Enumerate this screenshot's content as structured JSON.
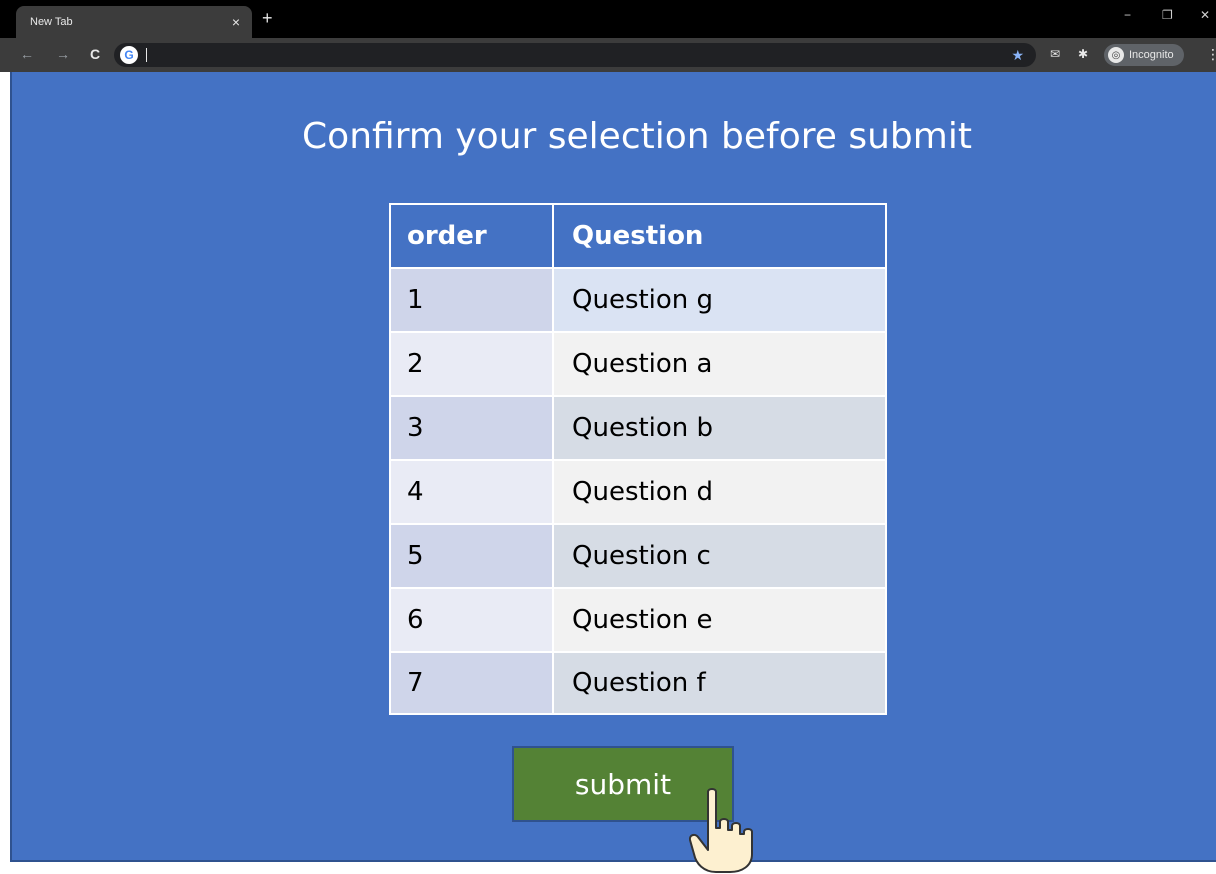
{
  "browser": {
    "tab_title": "New Tab",
    "tab_close": "×",
    "new_tab": "+",
    "minimize": "−",
    "restore": "❐",
    "close": "✕",
    "back": "←",
    "forward": "→",
    "reload": "C",
    "star": "★",
    "incognito_label": "Incognito",
    "menu": "⋮"
  },
  "page": {
    "heading": "Confirm your selection before submit",
    "table": {
      "headers": [
        "order",
        "Question"
      ],
      "rows": [
        [
          "1",
          "Question g"
        ],
        [
          "2",
          "Question a"
        ],
        [
          "3",
          "Question b"
        ],
        [
          "4",
          "Question d"
        ],
        [
          "5",
          "Question c"
        ],
        [
          "6",
          "Question e"
        ],
        [
          "7",
          "Question f"
        ]
      ]
    },
    "submit_label": "submit"
  },
  "colors": {
    "page_bg": "#4472c4",
    "submit_bg": "#548235"
  }
}
